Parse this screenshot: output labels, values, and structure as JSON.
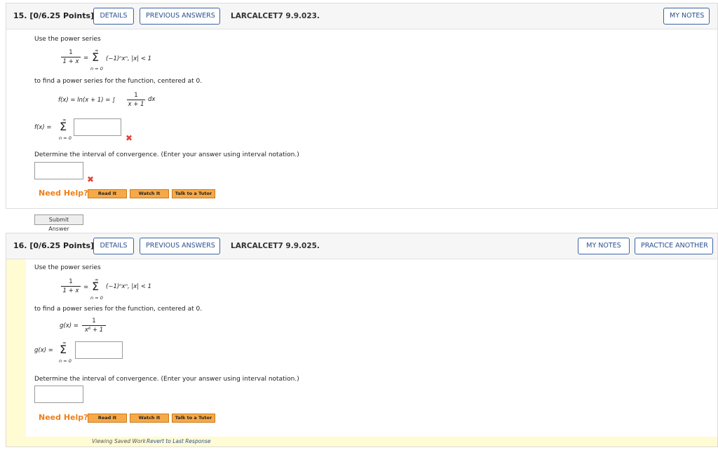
{
  "q15": {
    "number": "15. [0/6.25 Points]",
    "details": "DETAILS",
    "previous_answers": "PREVIOUS ANSWERS",
    "code": "LARCALCET7 9.9.023.",
    "my_notes": "MY NOTES",
    "intro": "Use the power series",
    "series_lhs_num": "1",
    "series_lhs_den": "1 + x",
    "series_rhs": "(−1)ⁿxⁿ,  |x| < 1",
    "sigma_top": "∞",
    "sigma_bottom": "n = 0",
    "find_text": "to find a power series for the function, centered at 0.",
    "function_lhs": "f(x) = ln(x + 1) = ∫",
    "function_frac_num": "1",
    "function_frac_den": "x + 1",
    "function_dx": "dx",
    "answer_lhs": "f(x) =",
    "interval_text": "Determine the interval of convergence. (Enter your answer using interval notation.)",
    "need_help": "Need Help?",
    "read_it": "Read It",
    "watch_it": "Watch It",
    "talk_tutor": "Talk to a Tutor",
    "submit": "Submit Answer"
  },
  "q16": {
    "number": "16. [0/6.25 Points]",
    "details": "DETAILS",
    "previous_answers": "PREVIOUS ANSWERS",
    "code": "LARCALCET7 9.9.025.",
    "my_notes": "MY NOTES",
    "practice_another": "PRACTICE ANOTHER",
    "intro": "Use the power series",
    "series_lhs_num": "1",
    "series_lhs_den": "1 + x",
    "series_rhs": "(−1)ⁿxⁿ,  |x| < 1",
    "sigma_top": "∞",
    "sigma_bottom": "n = 0",
    "find_text": "to find a power series for the function, centered at 0.",
    "function_lhs": "g(x) =",
    "function_frac_num": "1",
    "function_frac_den": "x⁶ + 1",
    "answer_lhs": "g(x) =",
    "interval_text": "Determine the interval of convergence. (Enter your answer using interval notation.)",
    "need_help": "Need Help?",
    "read_it": "Read It",
    "watch_it": "Watch It",
    "talk_tutor": "Talk to a Tutor",
    "footer_viewing": "Viewing Saved Work",
    "footer_revert": "Revert to Last Response"
  }
}
